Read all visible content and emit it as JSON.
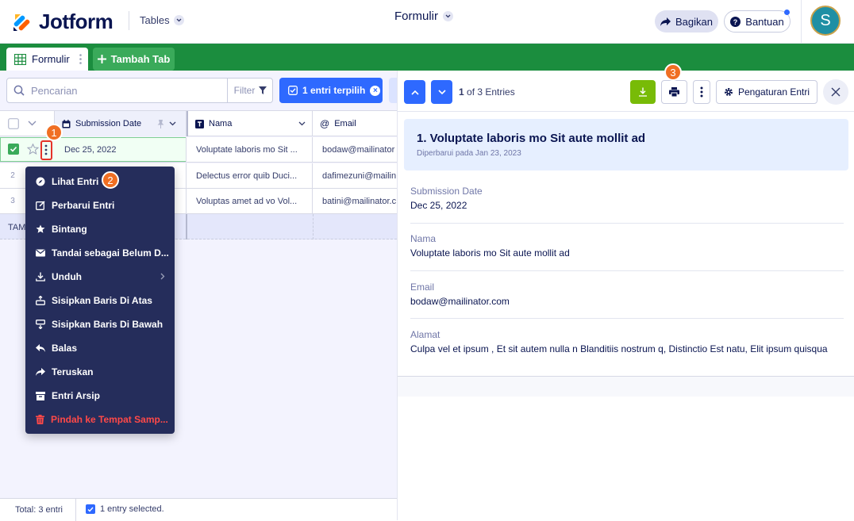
{
  "header": {
    "logo_text": "Jotform",
    "tables_label": "Tables",
    "form_title": "Formulir",
    "share_label": "Bagikan",
    "help_label": "Bantuan",
    "avatar_initial": "S"
  },
  "tabs": {
    "active_tab": "Formulir",
    "add_tab": "Tambah Tab"
  },
  "toolbar": {
    "search_placeholder": "Pencarian",
    "filter_label": "Filter",
    "selected_label": "1 entri terpilih"
  },
  "table": {
    "columns": [
      "Submission Date",
      "Nama",
      "Email"
    ],
    "rows": [
      {
        "num": "1",
        "date": "Dec 25, 2022",
        "nama": "Voluptate laboris mo Sit ...",
        "email": "bodaw@mailinator"
      },
      {
        "num": "2",
        "date": "",
        "nama": "Delectus error quib Duci...",
        "email": "dafimezuni@mailin"
      },
      {
        "num": "3",
        "date": "",
        "nama": "Voluptas amet ad vo Vol...",
        "email": "batini@mailinator.c"
      }
    ],
    "add_row_label": "TAM"
  },
  "footer": {
    "total": "Total: 3 entri",
    "selected": "1 entry selected."
  },
  "context_menu": {
    "items": [
      "Lihat Entri",
      "Perbarui Entri",
      "Bintang",
      "Tandai sebagai Belum D...",
      "Unduh",
      "Sisipkan Baris Di Atas",
      "Sisipkan Baris Di Bawah",
      "Balas",
      "Teruskan",
      "Entri Arsip",
      "Pindah ke Tempat Samp..."
    ]
  },
  "badges": {
    "one": "1",
    "two": "2",
    "three": "3"
  },
  "detail": {
    "counter_bold": "1",
    "counter_rest": " of 3 Entries",
    "settings_label": "Pengaturan Entri",
    "title": "1. Voluptate laboris mo Sit aute mollit ad",
    "updated": "Diperbarui pada Jan 23, 2023",
    "fields": [
      {
        "label": "Submission Date",
        "value": "Dec 25, 2022"
      },
      {
        "label": "Nama",
        "value": "Voluptate laboris mo Sit aute mollit ad"
      },
      {
        "label": "Email",
        "value": "bodaw@mailinator.com"
      },
      {
        "label": "Alamat",
        "value": "Culpa vel et ipsum , Et sit autem nulla n  Blanditiis nostrum q, Distinctio Est natu, Elit ipsum quisqua"
      }
    ]
  },
  "colors": {
    "brand_navy": "#0a1551",
    "tab_green": "#1b8d3e",
    "accent_blue": "#2e69ff",
    "download_green": "#78bb07",
    "badge_orange": "#f06f23",
    "menu_bg": "#252d5b",
    "danger_red": "#ff4948"
  }
}
